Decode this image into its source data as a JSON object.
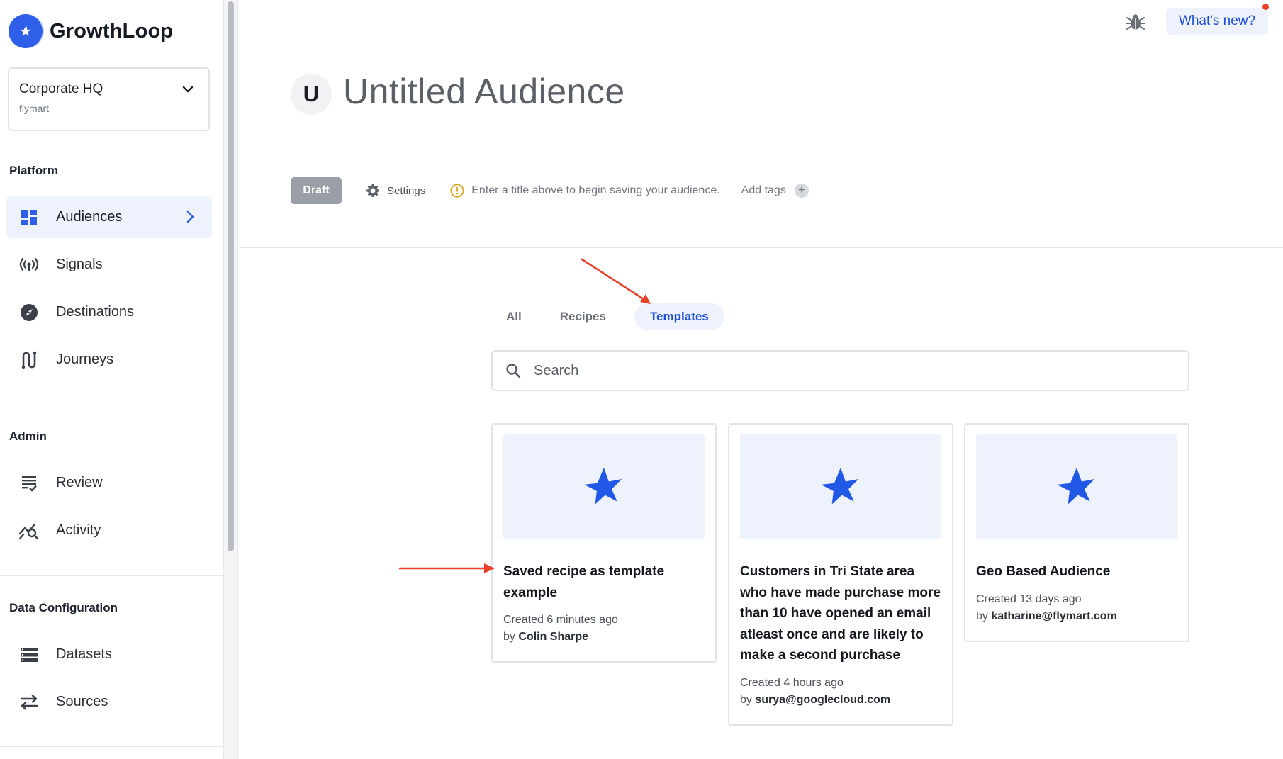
{
  "brand": {
    "name": "GrowthLoop"
  },
  "org": {
    "name": "Corporate HQ",
    "subtitle": "flymart"
  },
  "sections": {
    "platform": "Platform",
    "admin": "Admin",
    "data_config": "Data Configuration"
  },
  "nav": {
    "audiences": "Audiences",
    "signals": "Signals",
    "destinations": "Destinations",
    "journeys": "Journeys",
    "review": "Review",
    "activity": "Activity",
    "datasets": "Datasets",
    "sources": "Sources"
  },
  "topbar": {
    "whats_new": "What's new?"
  },
  "audience": {
    "avatar_letter": "U",
    "title": "Untitled Audience",
    "status": "Draft",
    "settings_label": "Settings",
    "warning": "Enter a title above to begin saving your audience.",
    "add_tags": "Add tags"
  },
  "tabs": [
    "All",
    "Recipes",
    "Templates"
  ],
  "active_tab": "Templates",
  "search": {
    "placeholder": "Search"
  },
  "cards": [
    {
      "title": "Saved recipe as template example",
      "created": "Created 6 minutes ago",
      "by_prefix": "by",
      "author": "Colin Sharpe"
    },
    {
      "title": "Customers in Tri State area who have made purchase more than 10 have opened an email atleast once and are likely to make a second purchase",
      "created": "Created 4 hours ago",
      "by_prefix": "by",
      "author": "surya@googlecloud.com"
    },
    {
      "title": "Geo Based Audience",
      "created": "Created 13 days ago",
      "by_prefix": "by",
      "author": "katharine@flymart.com"
    }
  ],
  "colors": {
    "accent": "#1f4fd8",
    "brand_blue": "#2f5ee8",
    "annotation_arrow": "#e8402a",
    "draft_badge": "#9a9ea7"
  }
}
